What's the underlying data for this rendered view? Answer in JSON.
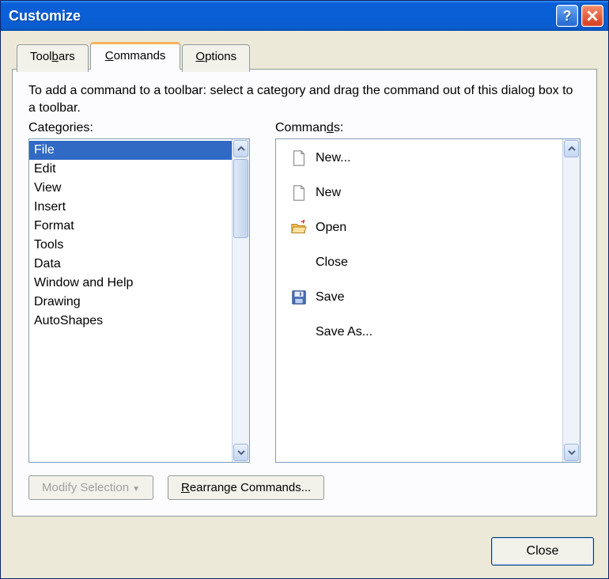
{
  "title": "Customize",
  "tabs": [
    {
      "label_pre": "Tool",
      "label_u": "b",
      "label_post": "ars",
      "active": false
    },
    {
      "label_pre": "",
      "label_u": "C",
      "label_post": "ommands",
      "active": true
    },
    {
      "label_pre": "",
      "label_u": "O",
      "label_post": "ptions",
      "active": false
    }
  ],
  "help_text": "To add a command to a toolbar: select a category and drag the command out of this dialog box to a toolbar.",
  "labels": {
    "categories_pre": "Cate",
    "categories_u": "g",
    "categories_post": "ories:",
    "commands_pre": "Comman",
    "commands_u": "d",
    "commands_post": "s:"
  },
  "categories": [
    {
      "label": "File",
      "selected": true
    },
    {
      "label": "Edit"
    },
    {
      "label": "View"
    },
    {
      "label": "Insert"
    },
    {
      "label": "Format"
    },
    {
      "label": "Tools"
    },
    {
      "label": "Data"
    },
    {
      "label": "Window and Help"
    },
    {
      "label": "Drawing"
    },
    {
      "label": "AutoShapes"
    }
  ],
  "commands": [
    {
      "label": "New...",
      "icon": "new-doc"
    },
    {
      "label": "New",
      "icon": "new-doc"
    },
    {
      "label": "Open",
      "icon": "folder-open"
    },
    {
      "label": "Close",
      "icon": ""
    },
    {
      "label": "Save",
      "icon": "save"
    },
    {
      "label": "Save As...",
      "icon": ""
    }
  ],
  "buttons": {
    "modify_selection": "Modify Selection",
    "rearrange_pre": "",
    "rearrange_u": "R",
    "rearrange_post": "earrange Commands...",
    "close": "Close"
  }
}
